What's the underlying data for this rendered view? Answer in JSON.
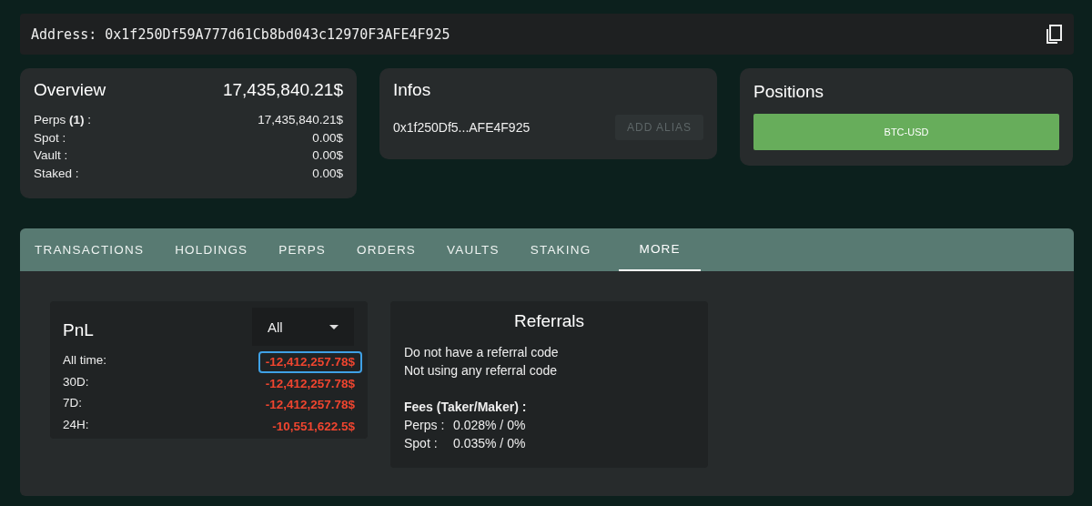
{
  "address_bar": {
    "text": "Address: 0x1f250Df59A777d61Cb8bd043c12970F3AFE4F925"
  },
  "overview": {
    "title": "Overview",
    "total": "17,435,840.21$",
    "rows": [
      {
        "label": "Perps **(1)** :",
        "value": "17,435,840.21$"
      },
      {
        "label": "Spot :",
        "value": "0.00$"
      },
      {
        "label": "Vault :",
        "value": "0.00$"
      },
      {
        "label": "Staked :",
        "value": "0.00$"
      }
    ]
  },
  "infos": {
    "title": "Infos",
    "address": "0x1f250Df5...AFE4F925",
    "button": {
      "label": "ADD ALIAS",
      "disabled": true
    }
  },
  "positions": {
    "title": "Positions",
    "items": [
      "BTC-USD"
    ]
  },
  "tabs": [
    {
      "label": "TRANSACTIONS",
      "selected": false
    },
    {
      "label": "HOLDINGS",
      "selected": false
    },
    {
      "label": "PERPS",
      "selected": false
    },
    {
      "label": "ORDERS",
      "selected": false
    },
    {
      "label": "VAULTS",
      "selected": false
    },
    {
      "label": "STAKING",
      "selected": false
    },
    {
      "label": "MORE",
      "selected": true
    }
  ],
  "pnl": {
    "title": "PnL",
    "period": "All",
    "rows": [
      {
        "label": "All time:",
        "value": "-12,412,257.78$",
        "highlighted": true
      },
      {
        "label": "30D:",
        "value": "-12,412,257.78$",
        "highlighted": false
      },
      {
        "label": "7D:",
        "value": "-12,412,257.78$",
        "highlighted": false
      },
      {
        "label": "24H:",
        "value": "-10,551,622.5$",
        "highlighted": false
      }
    ]
  },
  "referrals": {
    "title": "Referrals",
    "lines": [
      "Do not have a referral code",
      "Not using any referral code"
    ],
    "fees_title": "Fees (Taker/Maker) :",
    "fees": [
      {
        "label": "Perps :",
        "value": "0.028% / 0%"
      },
      {
        "label": "Spot :",
        "value": "0.035% / 0%"
      }
    ]
  }
}
